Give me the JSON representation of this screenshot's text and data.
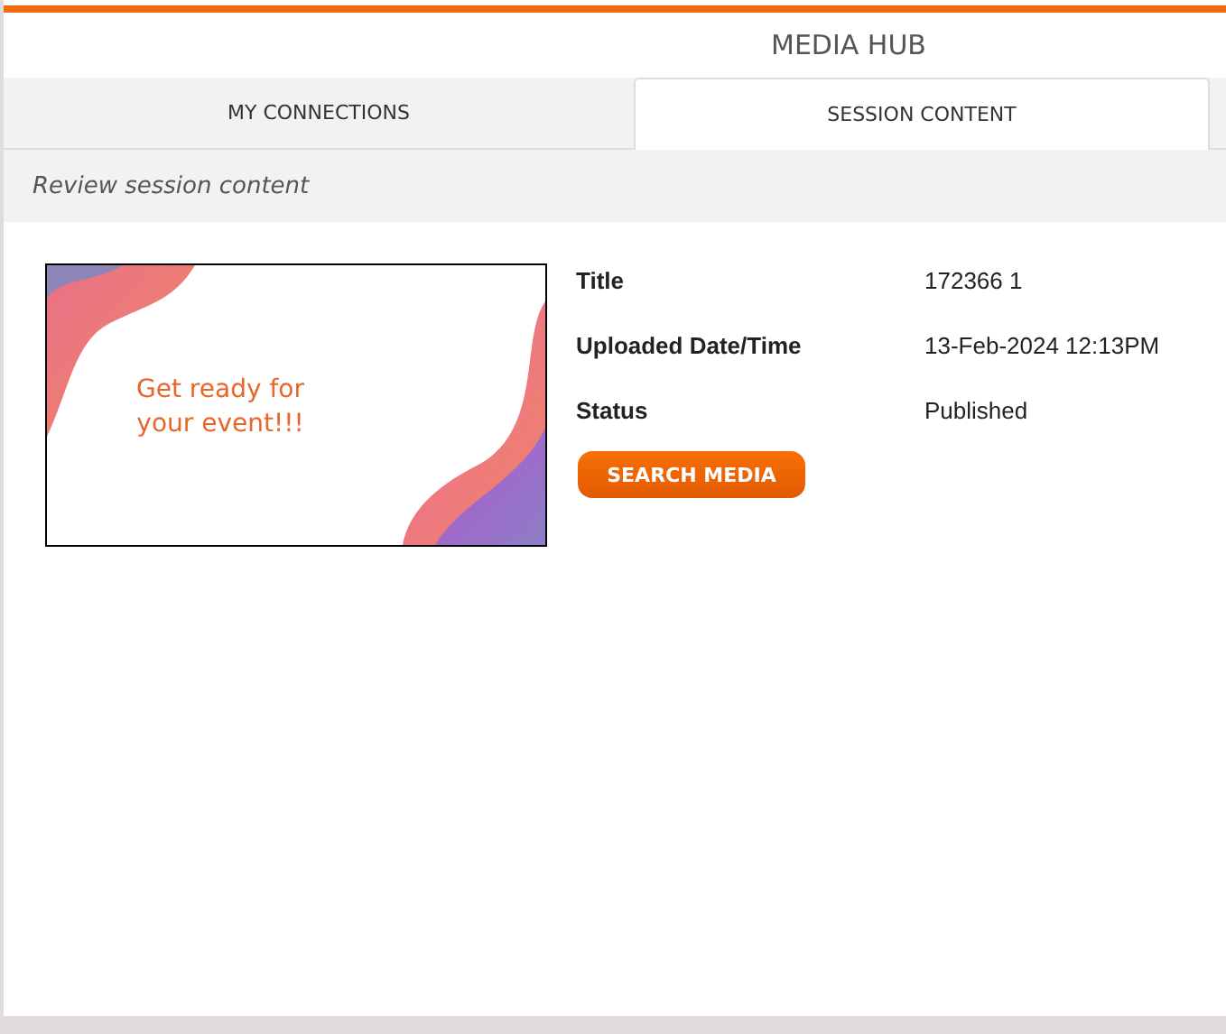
{
  "header": {
    "title": "MEDIA HUB"
  },
  "tabs": [
    {
      "label": "MY CONNECTIONS",
      "selected": false
    },
    {
      "label": "SESSION CONTENT",
      "selected": true
    }
  ],
  "subheader": "Review session content",
  "media": {
    "thumbnail_text": [
      "Get ready for",
      "your event!!!"
    ],
    "details": [
      {
        "label": "Title",
        "value": "172366 1"
      },
      {
        "label": "Uploaded Date/Time",
        "value": "13-Feb-2024 12:13PM"
      },
      {
        "label": "Status",
        "value": "Published"
      }
    ],
    "button": "SEARCH MEDIA"
  }
}
